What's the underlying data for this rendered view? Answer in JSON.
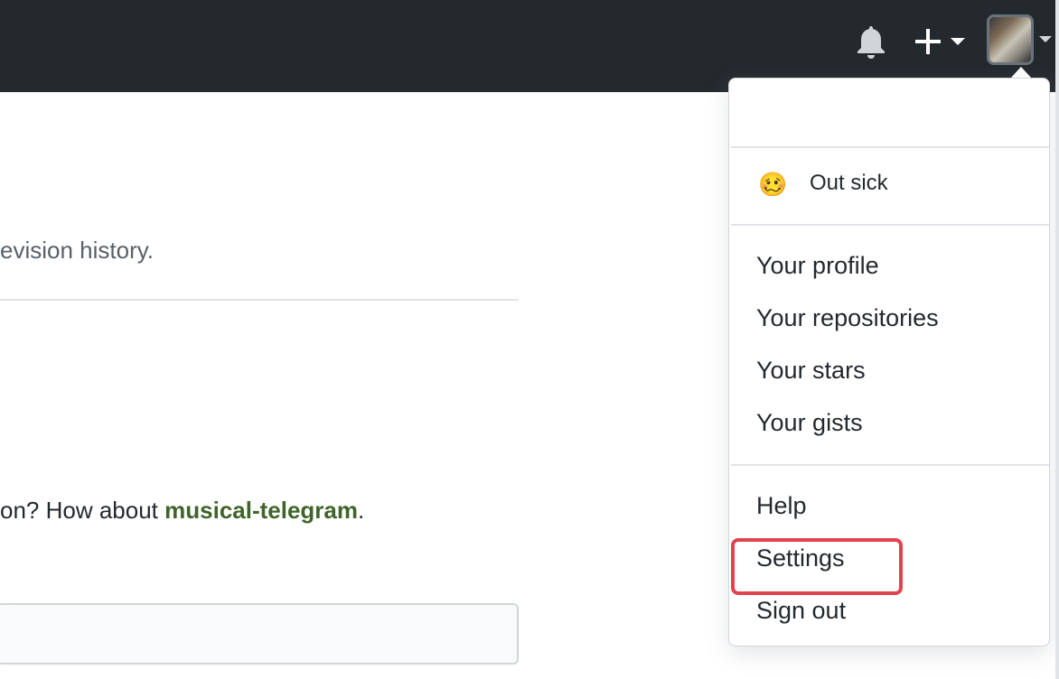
{
  "header": {
    "background": "#24292e",
    "icons": {
      "notifications": "bell-icon",
      "create_new": "plus-icon",
      "avatar_caret": "caret-down-icon"
    }
  },
  "content": {
    "text_fragment_1": "evision history.",
    "text_fragment_2_prefix": "on? How about ",
    "text_fragment_2_link": "musical-telegram",
    "text_fragment_2_suffix": ".",
    "link_color": "#40652a"
  },
  "dropdown": {
    "status": {
      "emoji": "🥴",
      "text": "Out sick"
    },
    "menu_group_1": [
      "Your profile",
      "Your repositories",
      "Your stars",
      "Your gists"
    ],
    "menu_group_2": [
      "Help",
      "Settings",
      "Sign out"
    ],
    "highlighted_item": "Settings",
    "highlight_color": "#e0434e"
  }
}
